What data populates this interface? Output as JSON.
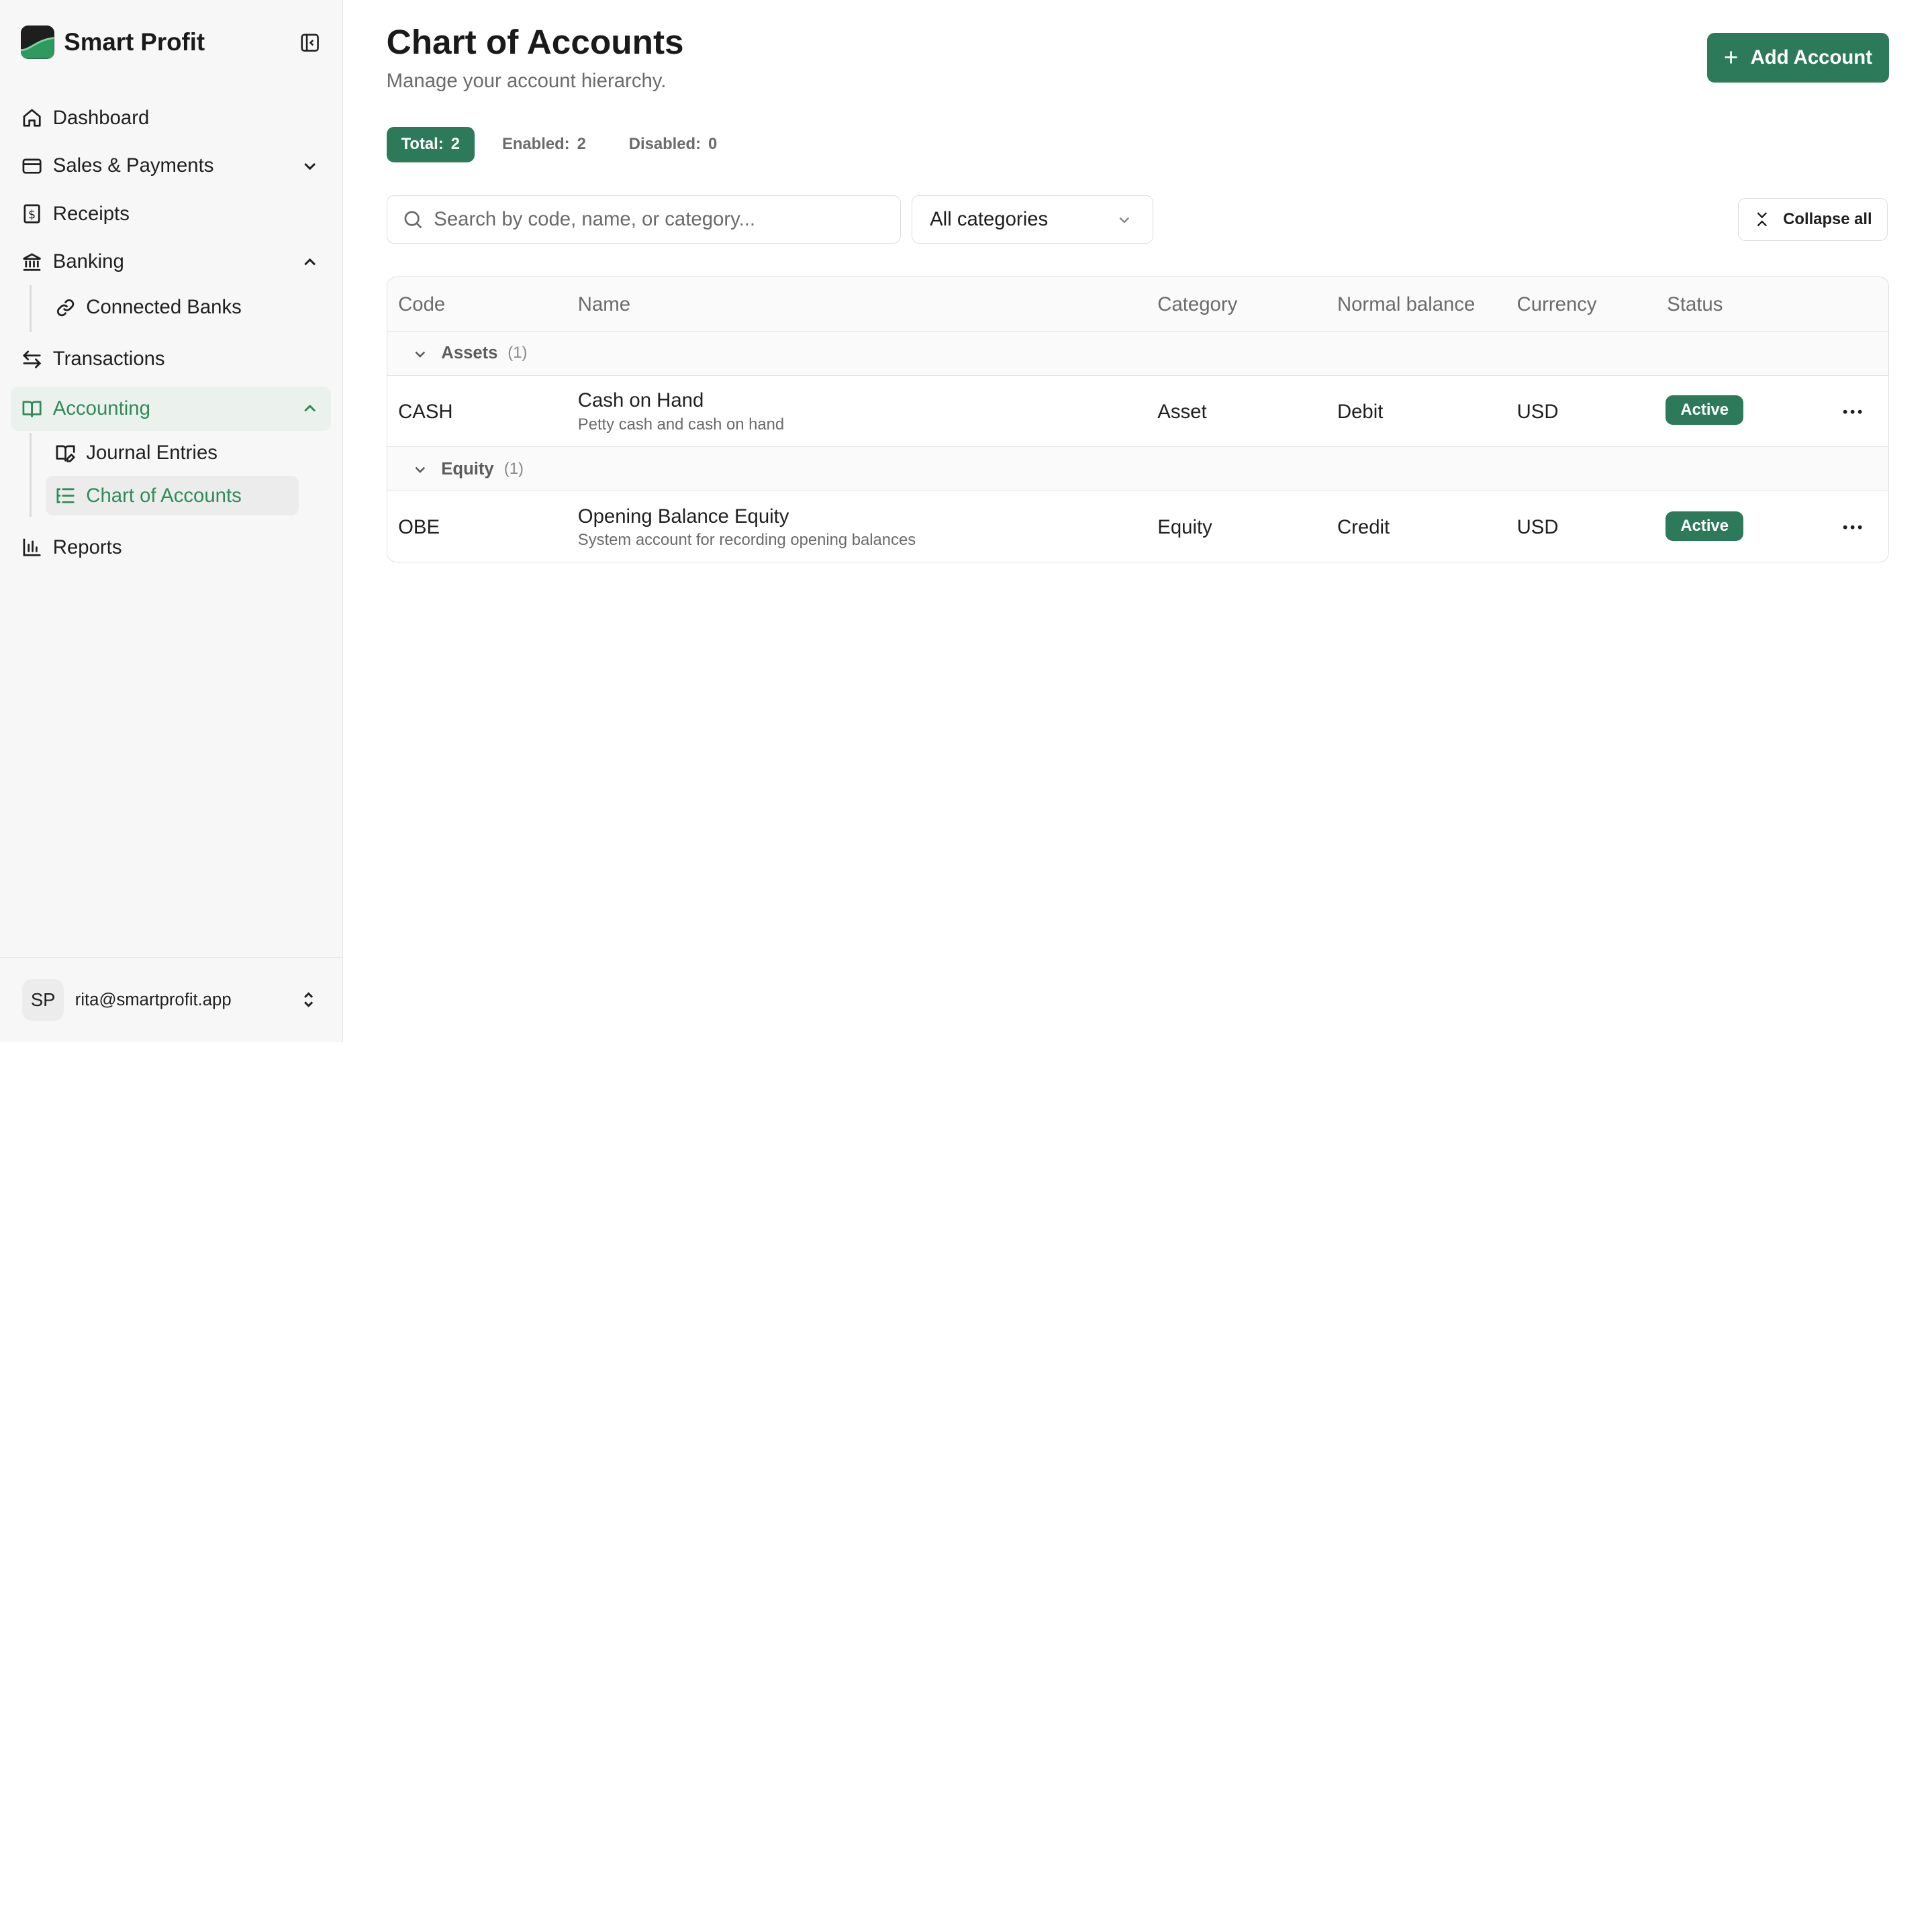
{
  "sidebar": {
    "brand": "Smart Profit",
    "nav": {
      "dashboard": "Dashboard",
      "sales": "Sales & Payments",
      "receipts": "Receipts",
      "banking": "Banking",
      "connected_banks": "Connected Banks",
      "transactions": "Transactions",
      "accounting": "Accounting",
      "journal_entries": "Journal Entries",
      "chart_of_accounts": "Chart of Accounts",
      "reports": "Reports"
    },
    "user": {
      "initials": "SP",
      "email": "rita@smartprofit.app"
    }
  },
  "header": {
    "title": "Chart of Accounts",
    "subtitle": "Manage your account hierarchy.",
    "add_button": "Add Account"
  },
  "stats": {
    "total_label": "Total:",
    "total_value": "2",
    "enabled_label": "Enabled:",
    "enabled_value": "2",
    "disabled_label": "Disabled:",
    "disabled_value": "0"
  },
  "filters": {
    "search_placeholder": "Search by code, name, or category...",
    "category_selected": "All categories",
    "collapse_all": "Collapse all"
  },
  "table": {
    "columns": {
      "code": "Code",
      "name": "Name",
      "category": "Category",
      "normal_balance": "Normal balance",
      "currency": "Currency",
      "status": "Status"
    },
    "groups": [
      {
        "name": "Assets",
        "count": "(1)",
        "rows": [
          {
            "code": "CASH",
            "name": "Cash on Hand",
            "description": "Petty cash and cash on hand",
            "category": "Asset",
            "normal_balance": "Debit",
            "currency": "USD",
            "status": "Active"
          }
        ]
      },
      {
        "name": "Equity",
        "count": "(1)",
        "rows": [
          {
            "code": "OBE",
            "name": "Opening Balance Equity",
            "description": "System account for recording opening balances",
            "category": "Equity",
            "normal_balance": "Credit",
            "currency": "USD",
            "status": "Active"
          }
        ]
      }
    ]
  },
  "colors": {
    "accent": "#2d7a5a",
    "accent_text": "#2e8b57",
    "sidebar_bg": "#f7f7f7"
  }
}
